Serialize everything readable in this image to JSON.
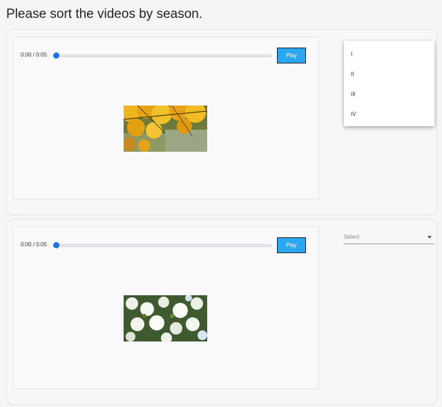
{
  "prompt": "Please sort the videos by season.",
  "videos": [
    {
      "time": "0:00 / 0:05",
      "play_label": "Play",
      "progress": 0,
      "thumbnail": "autumn-foliage-thumbnail",
      "dropdown": {
        "open": true,
        "options": [
          "I",
          "II",
          "III",
          "IV"
        ]
      }
    },
    {
      "time": "0:00 / 0:05",
      "play_label": "Play",
      "progress": 0,
      "thumbnail": "spring-blossom-thumbnail",
      "dropdown": {
        "open": false,
        "placeholder": "Select"
      }
    }
  ],
  "colors": {
    "play_button": "#29a7f0",
    "slider_thumb": "#1a73e8"
  }
}
